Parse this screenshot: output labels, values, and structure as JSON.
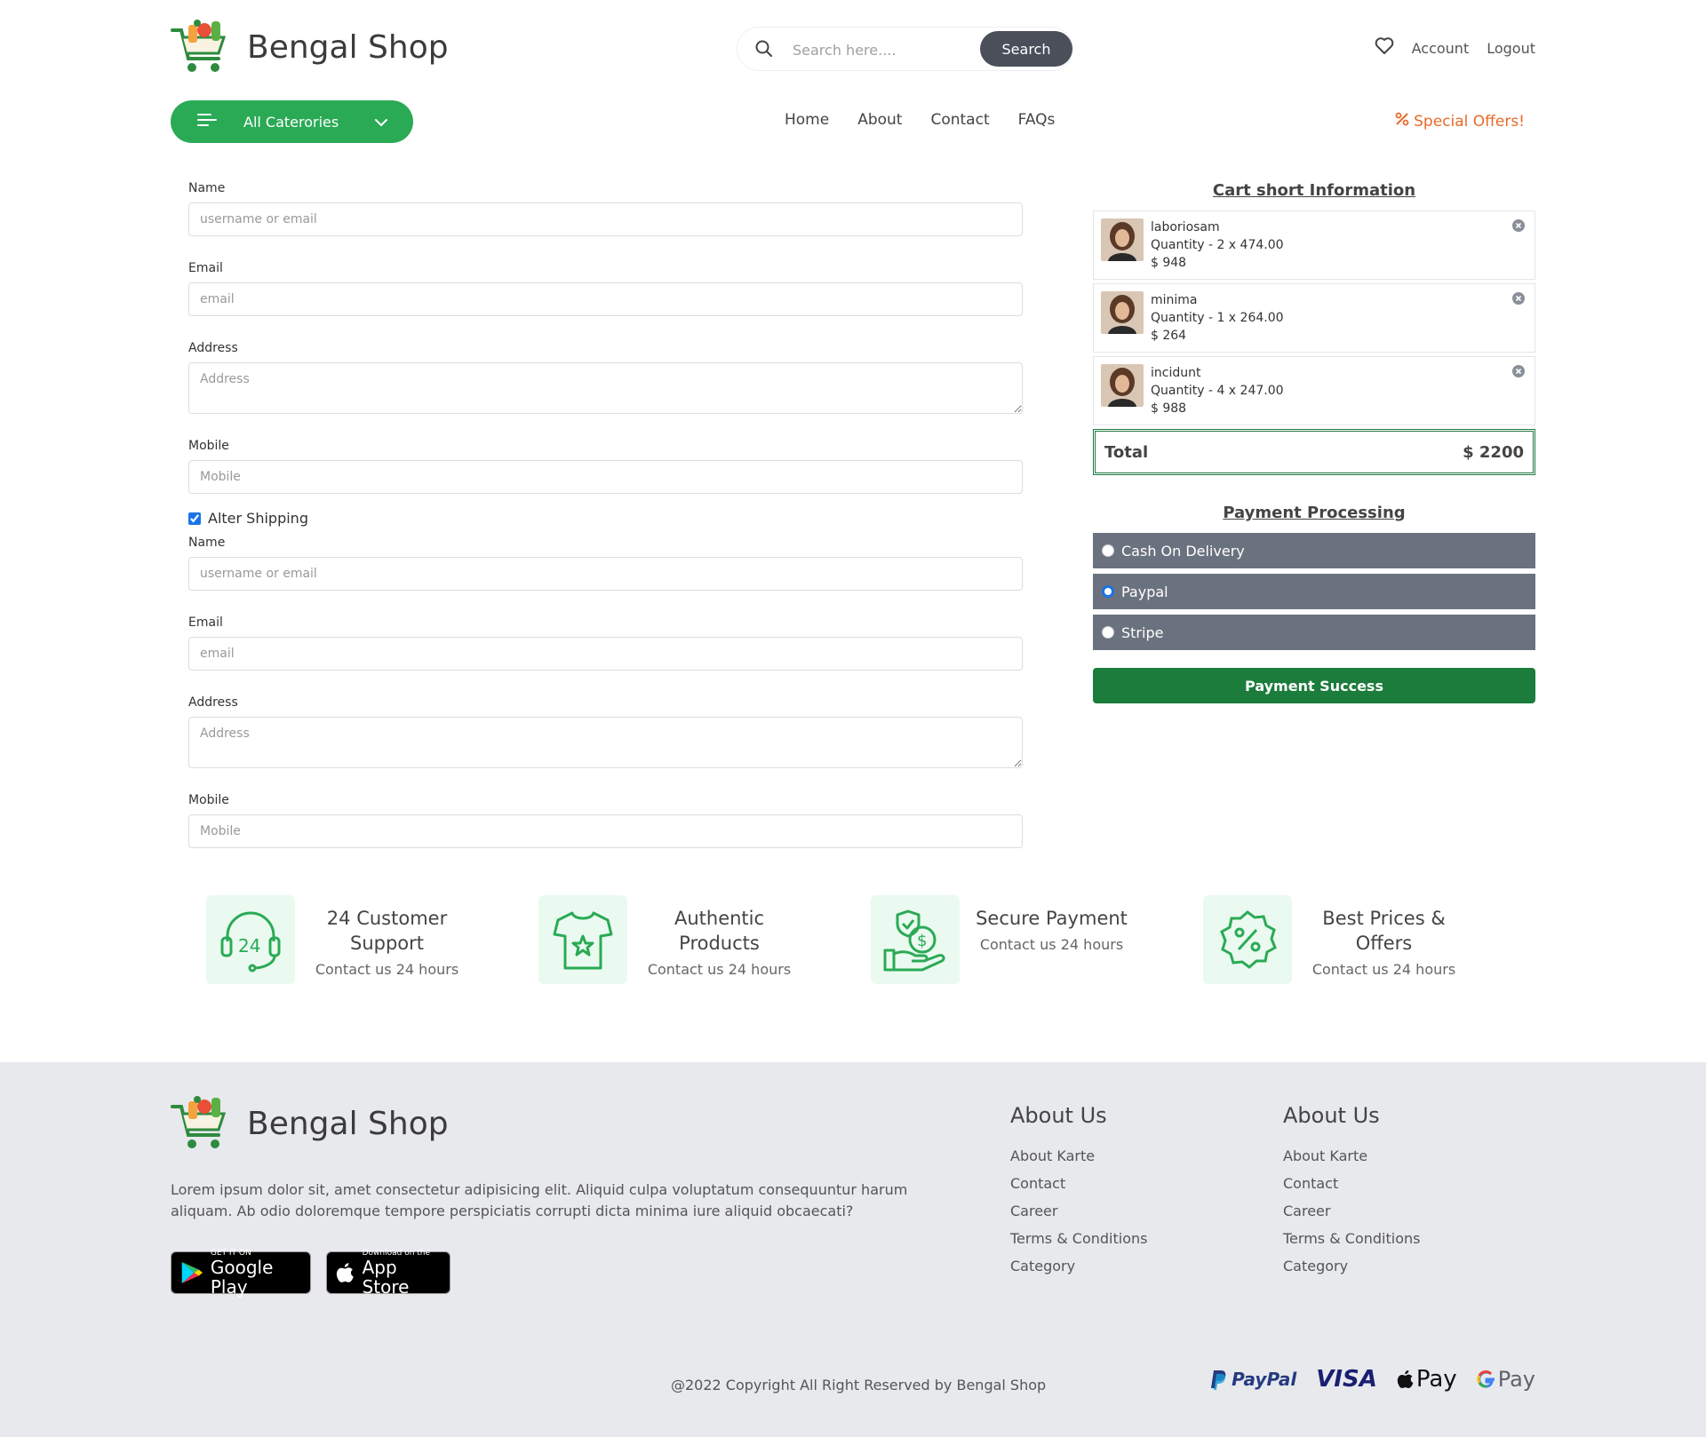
{
  "header": {
    "brand": "Bengal Shop",
    "search_placeholder": "Search here....",
    "search_button": "Search",
    "account": "Account",
    "logout": "Logout",
    "categories_button": "All Caterories",
    "nav": [
      "Home",
      "About",
      "Contact",
      "FAQs"
    ],
    "special_offers": "Special Offers!"
  },
  "form": {
    "billing": {
      "name_label": "Name",
      "name_placeholder": "username or email",
      "email_label": "Email",
      "email_placeholder": "email",
      "address_label": "Address",
      "address_placeholder": "Address",
      "mobile_label": "Mobile",
      "mobile_placeholder": "Mobile"
    },
    "alter_shipping_label": "Alter Shipping",
    "alter_shipping_checked": true,
    "shipping": {
      "name_label": "Name",
      "name_placeholder": "username or email",
      "email_label": "Email",
      "email_placeholder": "email",
      "address_label": "Address",
      "address_placeholder": "Address",
      "mobile_label": "Mobile",
      "mobile_placeholder": "Mobile"
    }
  },
  "cart": {
    "title": "Cart short Information",
    "items": [
      {
        "name": "laboriosam",
        "quantity": "Quantity - 2 x 474.00",
        "price": "$ 948"
      },
      {
        "name": "minima",
        "quantity": "Quantity - 1 x 264.00",
        "price": "$ 264"
      },
      {
        "name": "incidunt",
        "quantity": "Quantity - 4 x 247.00",
        "price": "$ 988"
      }
    ],
    "total_label": "Total",
    "total_value": "$ 2200"
  },
  "payment": {
    "title": "Payment Processing",
    "options": [
      "Cash On Delivery",
      "Paypal",
      "Stripe"
    ],
    "selected": "Paypal",
    "success_button": "Payment Success"
  },
  "features": [
    {
      "title": "24 Customer Support",
      "sub": "Contact us 24 hours",
      "icon": "headset-24-icon"
    },
    {
      "title": "Authentic Products",
      "sub": "Contact us 24 hours",
      "icon": "tshirt-star-icon"
    },
    {
      "title": "Secure Payment",
      "sub": "Contact us 24 hours",
      "icon": "hand-money-shield-icon"
    },
    {
      "title": "Best Prices & Offers",
      "sub": "Contact us 24 hours",
      "icon": "percent-badge-icon"
    }
  ],
  "footer": {
    "brand": "Bengal Shop",
    "description": "Lorem ipsum dolor sit, amet consectetur adipisicing elit. Aliquid culpa voluptatum consequuntur harum aliquam. Ab odio doloremque tempore perspiciatis corrupti dicta minima iure aliquid obcaecati?",
    "google_play_small": "GET IT ON",
    "google_play_big": "Google Play",
    "app_store_small": "Download on the",
    "app_store_big": "App Store",
    "columns": [
      {
        "title": "About Us",
        "links": [
          "About Karte",
          "Contact",
          "Career",
          "Terms & Conditions",
          "Category"
        ]
      },
      {
        "title": "About Us",
        "links": [
          "About Karte",
          "Contact",
          "Career",
          "Terms & Conditions",
          "Category"
        ]
      }
    ],
    "copyright": "@2022 Copyright All Right Reserved by Bengal Shop",
    "payment_logos": [
      "PayPal",
      "VISA",
      "Pay",
      "Pay"
    ]
  },
  "colors": {
    "brand_green": "#2aaa55",
    "dark_green": "#1b7c3c",
    "offer_orange": "#e8692a",
    "payment_option_bg": "#6b727f"
  }
}
